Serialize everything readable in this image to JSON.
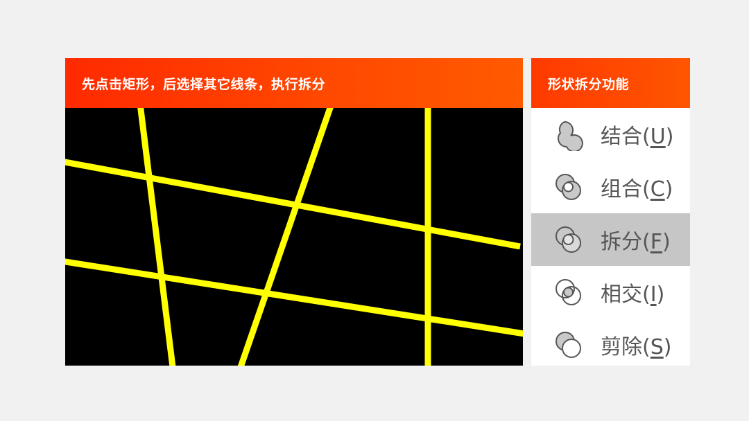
{
  "slide": {
    "title": "先点击矩形，后选择其它线条，执行拆分"
  },
  "panel": {
    "title": "形状拆分功能",
    "items": [
      {
        "name": "结合",
        "key": "U",
        "icon": "union-shapes-icon",
        "active": false
      },
      {
        "name": "组合",
        "key": "C",
        "icon": "combine-shapes-icon",
        "active": false
      },
      {
        "name": "拆分",
        "key": "F",
        "icon": "fragment-shapes-icon",
        "active": true
      },
      {
        "name": "相交",
        "key": "I",
        "icon": "intersect-shapes-icon",
        "active": false
      },
      {
        "name": "剪除",
        "key": "S",
        "icon": "subtract-shapes-icon",
        "active": false
      }
    ]
  },
  "colors": {
    "header_orange": "#ff4a00",
    "line_yellow": "#ffff00",
    "canvas_black": "#000000",
    "active_gray": "#c6c6c6"
  }
}
